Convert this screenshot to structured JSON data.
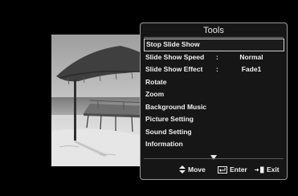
{
  "tools_menu": {
    "title": "Tools",
    "items": [
      {
        "label": "Stop Slide Show"
      },
      {
        "label": "Slide Show Speed",
        "separator": ":",
        "value": "Normal"
      },
      {
        "label": "Slide Show Effect",
        "separator": ":",
        "value": "Fade1"
      },
      {
        "label": "Rotate"
      },
      {
        "label": "Zoom"
      },
      {
        "label": "Background Music"
      },
      {
        "label": "Picture Setting"
      },
      {
        "label": "Sound Setting"
      },
      {
        "label": "Information"
      }
    ],
    "selected_index": 0
  },
  "footer": {
    "move_label": "Move",
    "enter_label": "Enter",
    "exit_label": "Exit"
  },
  "icons": {
    "move": "up-down-arrows-icon",
    "enter": "enter-icon",
    "exit": "exit-icon",
    "scroll": "scroll-down-triangle-icon"
  },
  "colors": {
    "background": "#000000",
    "menu_background": "#161616",
    "menu_border": "#9a9a9a",
    "text": "#f0f0f0"
  }
}
